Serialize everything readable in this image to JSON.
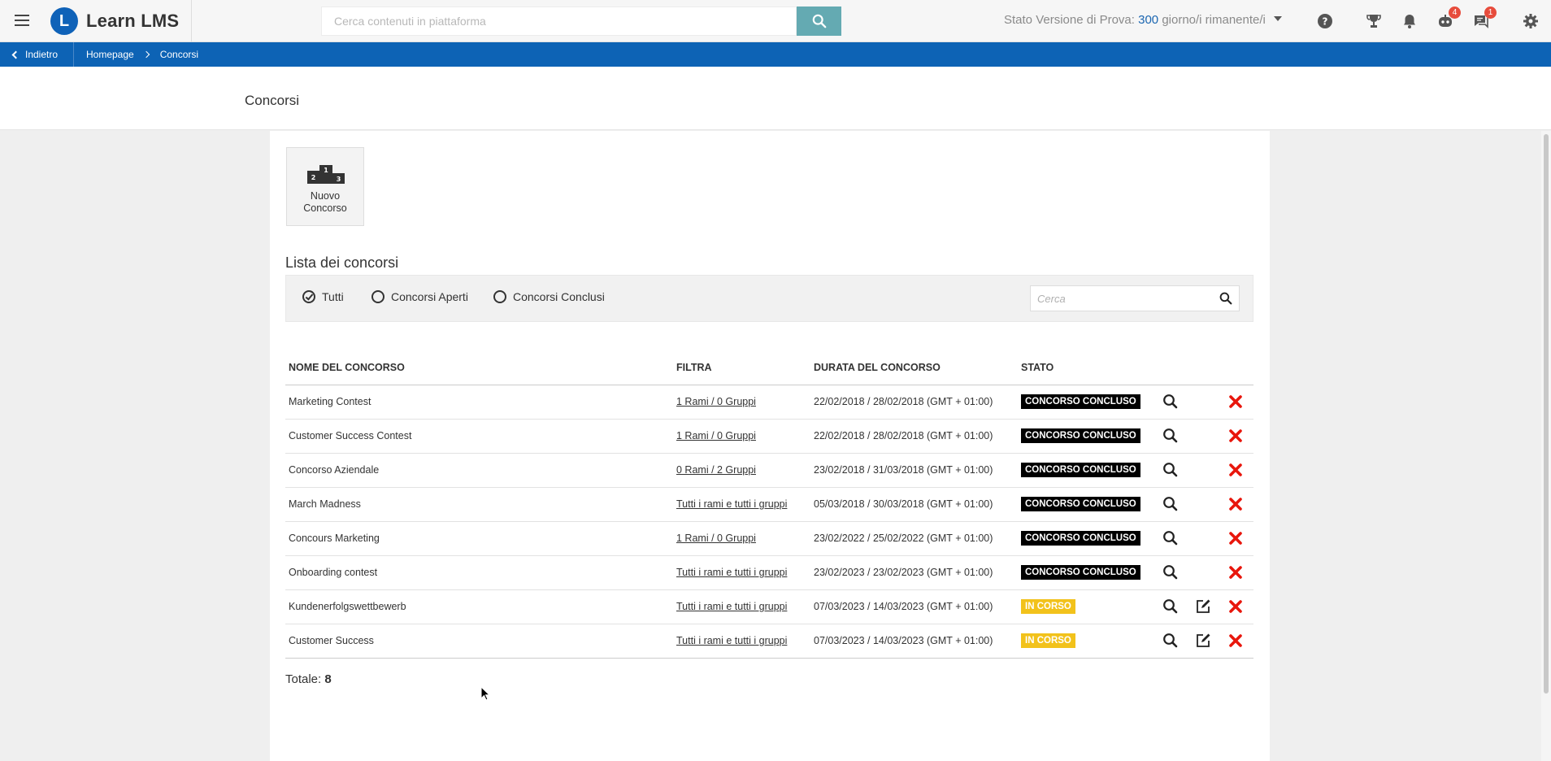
{
  "app": {
    "name": "Learn LMS",
    "logo_letter": "L"
  },
  "header": {
    "search_placeholder": "Cerca contenuti in piattaforma",
    "trial_prefix": "Stato Versione di Prova:",
    "trial_days": "300",
    "trial_suffix": "giorno/i rimanente/i",
    "badges": {
      "robot": "4",
      "chat": "1"
    }
  },
  "breadcrumb": {
    "back": "Indietro",
    "items": [
      "Homepage",
      "Concorsi"
    ]
  },
  "page": {
    "title": "Concorsi"
  },
  "new_card": {
    "line1": "Nuovo",
    "line2": "Concorso",
    "podium": [
      "2",
      "1",
      "3"
    ]
  },
  "list": {
    "title": "Lista dei concorsi",
    "filters": [
      "Tutti",
      "Concorsi Aperti",
      "Concorsi Conclusi"
    ],
    "selected_filter": "Tutti",
    "search_placeholder": "Cerca",
    "columns": [
      "NOME DEL CONCORSO",
      "FILTRA",
      "DURATA DEL CONCORSO",
      "STATO"
    ],
    "rows": [
      {
        "name": "Marketing Contest",
        "filter": "1 Rami / 0 Gruppi",
        "duration": "22/02/2018 / 28/02/2018 (GMT + 01:00)",
        "status": "CONCORSO CONCLUSO",
        "editable": false
      },
      {
        "name": "Customer Success Contest",
        "filter": "1 Rami / 0 Gruppi",
        "duration": "22/02/2018 / 28/02/2018 (GMT + 01:00)",
        "status": "CONCORSO CONCLUSO",
        "editable": false
      },
      {
        "name": "Concorso Aziendale",
        "filter": "0 Rami / 2 Gruppi",
        "duration": "23/02/2018 / 31/03/2018 (GMT + 01:00)",
        "status": "CONCORSO CONCLUSO",
        "editable": false
      },
      {
        "name": "March Madness",
        "filter": "Tutti i rami e tutti i gruppi",
        "duration": "05/03/2018 / 30/03/2018 (GMT + 01:00)",
        "status": "CONCORSO CONCLUSO",
        "editable": false
      },
      {
        "name": "Concours Marketing",
        "filter": "1 Rami / 0 Gruppi",
        "duration": "23/02/2022 / 25/02/2022 (GMT + 01:00)",
        "status": "CONCORSO CONCLUSO",
        "editable": false
      },
      {
        "name": "Onboarding contest",
        "filter": "Tutti i rami e tutti i gruppi",
        "duration": "23/02/2023 / 23/02/2023 (GMT + 01:00)",
        "status": "CONCORSO CONCLUSO",
        "editable": false
      },
      {
        "name": "Kundenerfolgswettbewerb",
        "filter": "Tutti i rami e tutti i gruppi",
        "duration": "07/03/2023 / 14/03/2023 (GMT + 01:00)",
        "status": "IN CORSO",
        "editable": true
      },
      {
        "name": "Customer Success",
        "filter": "Tutti i rami e tutti i gruppi",
        "duration": "07/03/2023 / 14/03/2023 (GMT + 01:00)",
        "status": "IN CORSO",
        "editable": true
      }
    ],
    "total_label": "Totale:",
    "total_value": "8"
  },
  "colors": {
    "primary": "#0d63b5",
    "search_button": "#64aab2",
    "status_done": "#000000",
    "status_running": "#f2c21b",
    "delete": "#e8160c",
    "badge": "#e74c3c"
  },
  "icons": {
    "header": [
      "menu-icon",
      "search-icon",
      "caret-down-icon",
      "help-icon",
      "trophy-icon",
      "bell-icon",
      "robot-icon",
      "chat-icon",
      "gear-icon"
    ],
    "row_actions": [
      "magnifier-icon",
      "edit-icon",
      "delete-icon"
    ]
  }
}
